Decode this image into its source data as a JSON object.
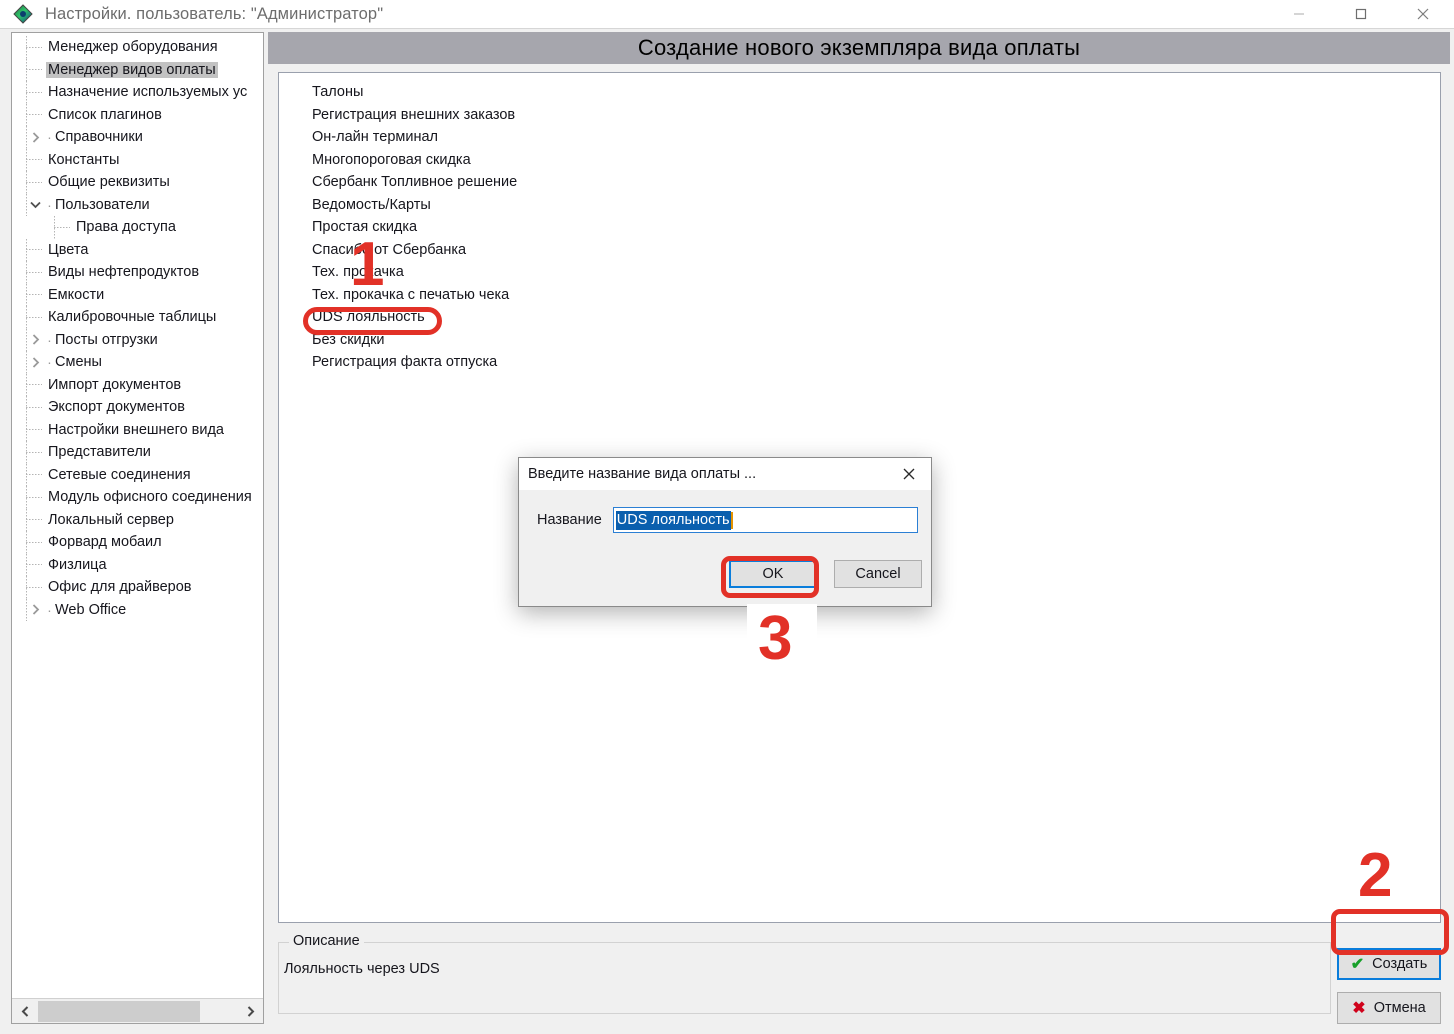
{
  "window": {
    "title": "Настройки. пользователь: \"Администратор\"",
    "icon": "diamond-app-icon",
    "controls": {
      "minimize": "minimize-icon",
      "maximize": "maximize-icon",
      "close": "close-icon"
    }
  },
  "sidebar": {
    "items": [
      {
        "label": "Менеджер оборудования",
        "kind": "leaf",
        "selected": false,
        "indent": 0
      },
      {
        "label": "Менеджер видов оплаты",
        "kind": "leaf",
        "selected": true,
        "indent": 0
      },
      {
        "label": "Назначение используемых ус",
        "kind": "leaf",
        "selected": false,
        "indent": 0
      },
      {
        "label": "Список плагинов",
        "kind": "leaf",
        "selected": false,
        "indent": 0
      },
      {
        "label": "Справочники",
        "kind": "collapsed",
        "selected": false,
        "indent": 0
      },
      {
        "label": "Константы",
        "kind": "leaf",
        "selected": false,
        "indent": 0
      },
      {
        "label": "Общие реквизиты",
        "kind": "leaf",
        "selected": false,
        "indent": 0
      },
      {
        "label": "Пользователи",
        "kind": "expanded",
        "selected": false,
        "indent": 0
      },
      {
        "label": "Права доступа",
        "kind": "leaf",
        "selected": false,
        "indent": 1
      },
      {
        "label": "Цвета",
        "kind": "leaf",
        "selected": false,
        "indent": 0
      },
      {
        "label": "Виды нефтепродуктов",
        "kind": "leaf",
        "selected": false,
        "indent": 0
      },
      {
        "label": "Емкости",
        "kind": "leaf",
        "selected": false,
        "indent": 0
      },
      {
        "label": "Калибровочные таблицы",
        "kind": "leaf",
        "selected": false,
        "indent": 0
      },
      {
        "label": "Посты отгрузки",
        "kind": "collapsed",
        "selected": false,
        "indent": 0
      },
      {
        "label": "Смены",
        "kind": "collapsed",
        "selected": false,
        "indent": 0
      },
      {
        "label": "Импорт документов",
        "kind": "leaf",
        "selected": false,
        "indent": 0
      },
      {
        "label": "Экспорт документов",
        "kind": "leaf",
        "selected": false,
        "indent": 0
      },
      {
        "label": "Настройки внешнего вида",
        "kind": "leaf",
        "selected": false,
        "indent": 0
      },
      {
        "label": "Представители",
        "kind": "leaf",
        "selected": false,
        "indent": 0
      },
      {
        "label": "Сетевые соединения",
        "kind": "leaf",
        "selected": false,
        "indent": 0
      },
      {
        "label": "Модуль офисного соединения",
        "kind": "leaf",
        "selected": false,
        "indent": 0
      },
      {
        "label": "Локальный сервер",
        "kind": "leaf",
        "selected": false,
        "indent": 0
      },
      {
        "label": "Форвард мобаил",
        "kind": "leaf",
        "selected": false,
        "indent": 0
      },
      {
        "label": "Физлица",
        "kind": "leaf",
        "selected": false,
        "indent": 0
      },
      {
        "label": "Офис для драйверов",
        "kind": "leaf",
        "selected": false,
        "indent": 0
      },
      {
        "label": "Web Office",
        "kind": "collapsed",
        "selected": false,
        "indent": 0
      }
    ],
    "scrollbar": {
      "left_arrow": "chevron-left-icon",
      "right_arrow": "chevron-right-icon"
    }
  },
  "main": {
    "header_title": "Создание нового экземпляра вида оплаты",
    "payment_types": [
      "Талоны",
      "Регистрация внешних заказов",
      "Он-лайн терминал",
      "Многопороговая скидка",
      "Сбербанк Топливное решение",
      "Ведомость/Карты",
      "Простая скидка",
      "Спасибо от Сбербанка",
      "Тех. прокачка",
      "Тех. прокачка с печатью чека",
      "UDS лояльность",
      "Без скидки",
      "Регистрация факта отпуска"
    ],
    "selected_payment_type": "UDS лояльность",
    "description": {
      "legend": "Описание",
      "text": "Лояльность через UDS"
    },
    "buttons": {
      "create": "Создать",
      "cancel": "Отмена"
    }
  },
  "dialog": {
    "title": "Введите название вида оплаты ...",
    "close": "close-icon",
    "field_label": "Название",
    "field_value": "UDS лояльность",
    "field_placeholder": "",
    "ok": "OK",
    "cancel": "Cancel"
  },
  "annotations": [
    {
      "number": "1",
      "target": "payment-type-uds"
    },
    {
      "number": "2",
      "target": "create-button"
    },
    {
      "number": "3",
      "target": "dialog-ok-button"
    }
  ],
  "colors": {
    "annotation_red": "#e23127",
    "header_gray": "#a6a6ad",
    "focus_blue": "#0a7ddb",
    "selection_blue": "#0a5fae",
    "check_green": "#17a02a",
    "x_red": "#d0021b"
  }
}
